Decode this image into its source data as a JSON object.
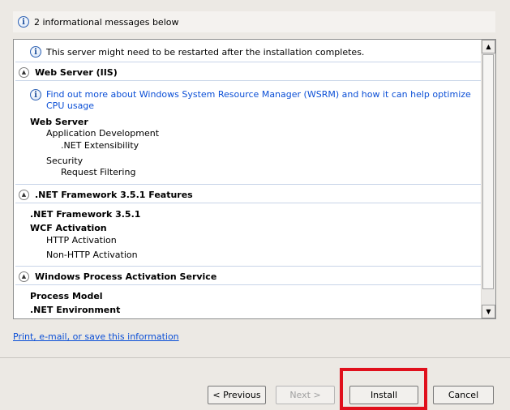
{
  "banner": {
    "text": "2 informational messages below"
  },
  "messages": {
    "restart": "This server might need to be restarted after the installation completes.",
    "wsrm_line1": "Find out more about Windows System Resource Manager (WSRM) and how it can help optimize",
    "wsrm_line2": "CPU usage"
  },
  "sections": {
    "web_server_iis": "Web Server (IIS)",
    "web_server": "Web Server",
    "app_dev": "Application Development",
    "net_ext": ".NET Extensibility",
    "security": "Security",
    "request_filtering": "Request Filtering",
    "net_features": ".NET Framework 3.5.1 Features",
    "net_framework": ".NET Framework 3.5.1",
    "wcf": "WCF Activation",
    "http_activation": "HTTP Activation",
    "non_http_activation": "Non-HTTP Activation",
    "was": "Windows Process Activation Service",
    "process_model": "Process Model",
    "net_environment": ".NET Environment"
  },
  "print_link": "Print, e-mail, or save this information",
  "buttons": {
    "previous": "< Previous",
    "next": "Next >",
    "install": "Install",
    "cancel": "Cancel"
  },
  "icons": {
    "info": "info-icon",
    "collapse": "chevron-up-circle-icon",
    "scroll_up": "scroll-up-arrow-icon",
    "scroll_down": "scroll-down-arrow-icon"
  },
  "colors": {
    "link": "#0b4fd6",
    "highlight": "#e0101c",
    "background": "#ece9e4"
  }
}
